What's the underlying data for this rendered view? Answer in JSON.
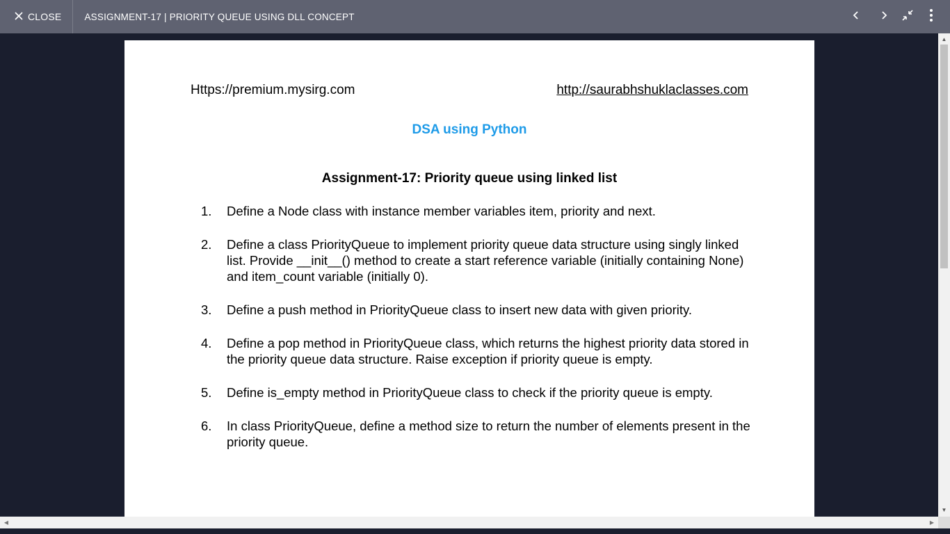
{
  "topbar": {
    "close_label": "CLOSE",
    "title": "ASSIGNMENT-17 | PRIORITY QUEUE USING DLL CONCEPT",
    "icons": [
      "close-icon",
      "chevron-left-icon",
      "chevron-right-icon",
      "exit-fullscreen-icon",
      "more-vertical-icon"
    ]
  },
  "document": {
    "header_left": "Https://premium.mysirg.com",
    "header_right": "http://saurabhshuklaclasses.com",
    "subject": "DSA using Python",
    "assignment_title": "Assignment-17: Priority queue using linked list",
    "tasks": [
      {
        "num": "1.",
        "text": "Define a Node class with instance member variables item, priority and next."
      },
      {
        "num": "2.",
        "text": "Define a class PriorityQueue to implement priority queue data structure using singly linked list. Provide __init__() method to create a start reference variable (initially containing None) and item_count variable (initially 0)."
      },
      {
        "num": "3.",
        "text": "Define a push method in PriorityQueue class to insert new data with given priority."
      },
      {
        "num": "4.",
        "text": "Define a pop method in PriorityQueue class, which returns the highest priority data stored in the priority queue data structure. Raise exception if priority queue is empty."
      },
      {
        "num": "5.",
        "text": "Define is_empty method in PriorityQueue class to check if the priority queue is empty."
      },
      {
        "num": "6.",
        "text": "In class PriorityQueue, define a method size to return the number of elements present in the priority queue."
      }
    ]
  },
  "colors": {
    "topbar_bg": "#5f6271",
    "viewer_bg": "#1a1e2e",
    "subject_color": "#1e9be8"
  }
}
